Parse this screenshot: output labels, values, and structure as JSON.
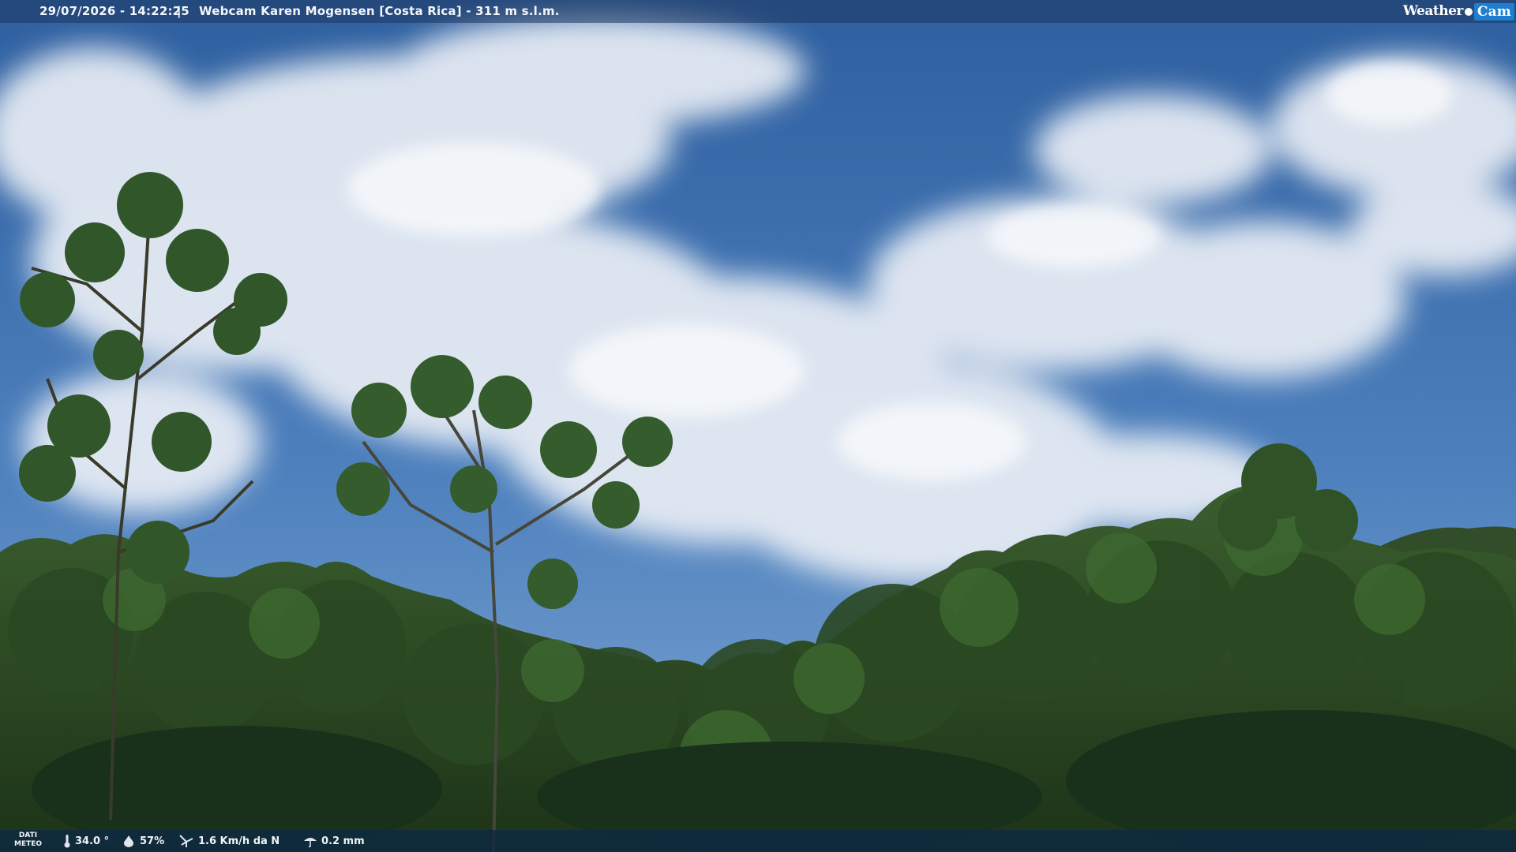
{
  "header": {
    "timestamp": "29/07/2026 - 14:22:25",
    "separator": "|",
    "title": "Webcam Karen Mogensen [Costa Rica] - 311 m s.l.m.",
    "logo_text_1": "Weather",
    "logo_text_2": "Cam"
  },
  "footer": {
    "label_line1": "DATI",
    "label_line2": "METEO",
    "temperature": "34.0 °",
    "humidity": "57%",
    "wind": "1.6 Km/h da N",
    "rain": "0.2 mm"
  },
  "colors": {
    "sky": "#3d6fae",
    "cloud": "#e8eef5",
    "foliage": "#2c4a22",
    "logo_accent": "#1e7fd0"
  },
  "icons": [
    "thermometer-icon",
    "humidity-icon",
    "wind-icon",
    "rain-icon"
  ]
}
